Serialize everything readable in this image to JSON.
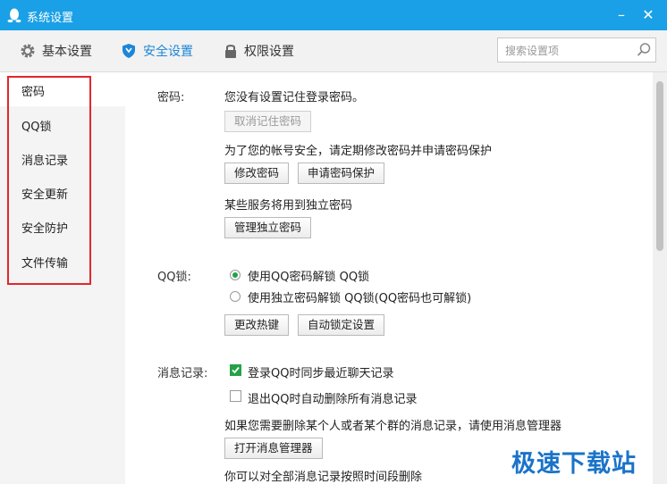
{
  "window": {
    "title": "系统设置"
  },
  "tabs": [
    {
      "label": "基本设置",
      "icon": "gear-icon"
    },
    {
      "label": "安全设置",
      "icon": "shield-icon"
    },
    {
      "label": "权限设置",
      "icon": "lock-icon"
    }
  ],
  "search": {
    "placeholder": "搜索设置项"
  },
  "sidebar": {
    "items": [
      "密码",
      "QQ锁",
      "消息记录",
      "安全更新",
      "安全防护",
      "文件传输"
    ],
    "selected": "密码"
  },
  "password": {
    "label": "密码:",
    "status": "您没有设置记住登录密码。",
    "cancel_button": "取消记住密码",
    "advice": "为了您的帐号安全，请定期修改密码并申请密码保护",
    "modify_button": "修改密码",
    "protect_button": "申请密码保护",
    "independent_note": "某些服务将用到独立密码",
    "manage_button": "管理独立密码"
  },
  "qqlock": {
    "label": "QQ锁:",
    "option1": "使用QQ密码解锁 QQ锁",
    "option2": "使用独立密码解锁 QQ锁(QQ密码也可解锁)",
    "hotkey_button": "更改热键",
    "autolock_button": "自动锁定设置"
  },
  "messages": {
    "label": "消息记录:",
    "sync_option": "登录QQ时同步最近聊天记录",
    "delete_option": "退出QQ时自动删除所有消息记录",
    "manager_note": "如果您需要删除某个人或者某个群的消息记录，请使用消息管理器",
    "manager_button": "打开消息管理器",
    "period_note": "你可以对全部消息记录按照时间段删除"
  },
  "watermark": "极速下载站",
  "colors": {
    "titlebar": "#1aa0e6",
    "accent": "#1d86d8",
    "check": "#24a147",
    "highlight": "#e3262d"
  }
}
